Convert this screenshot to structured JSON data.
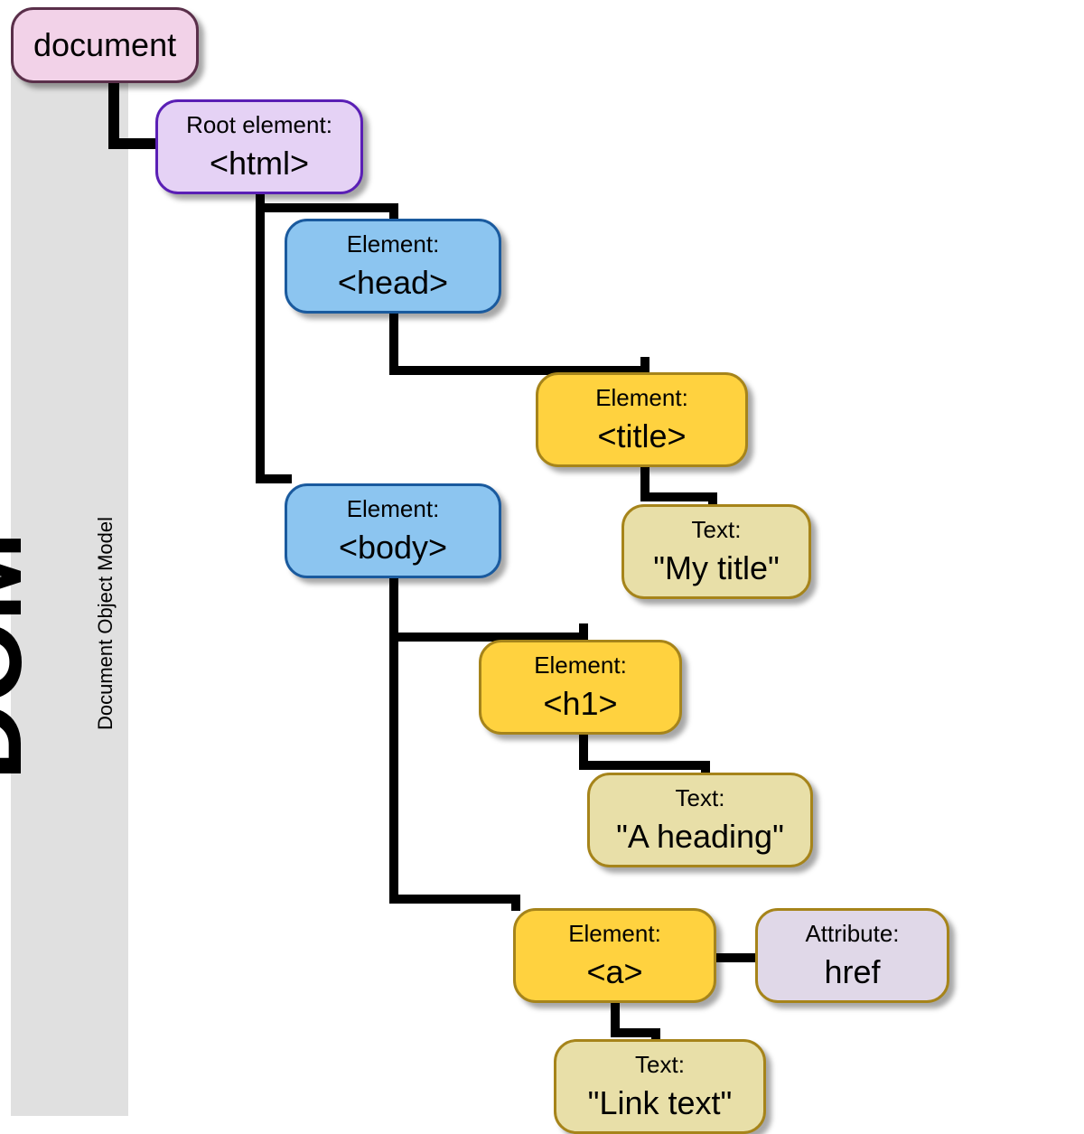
{
  "sidebar": {
    "title": "DOM",
    "subtitle": "Document Object Model"
  },
  "nodes": {
    "document": {
      "label": "document"
    },
    "root": {
      "line1": "Root element:",
      "line2": "<html>"
    },
    "head": {
      "line1": "Element:",
      "line2": "<head>"
    },
    "title": {
      "line1": "Element:",
      "line2": "<title>"
    },
    "body": {
      "line1": "Element:",
      "line2": "<body>"
    },
    "titleText": {
      "line1": "Text:",
      "line2": "\"My title\""
    },
    "h1": {
      "line1": "Element:",
      "line2": "<h1>"
    },
    "h1Text": {
      "line1": "Text:",
      "line2": "\"A heading\""
    },
    "a": {
      "line1": "Element:",
      "line2": "<a>"
    },
    "href": {
      "line1": "Attribute:",
      "line2": "href"
    },
    "aText": {
      "line1": "Text:",
      "line2": "\"Link text\""
    }
  }
}
